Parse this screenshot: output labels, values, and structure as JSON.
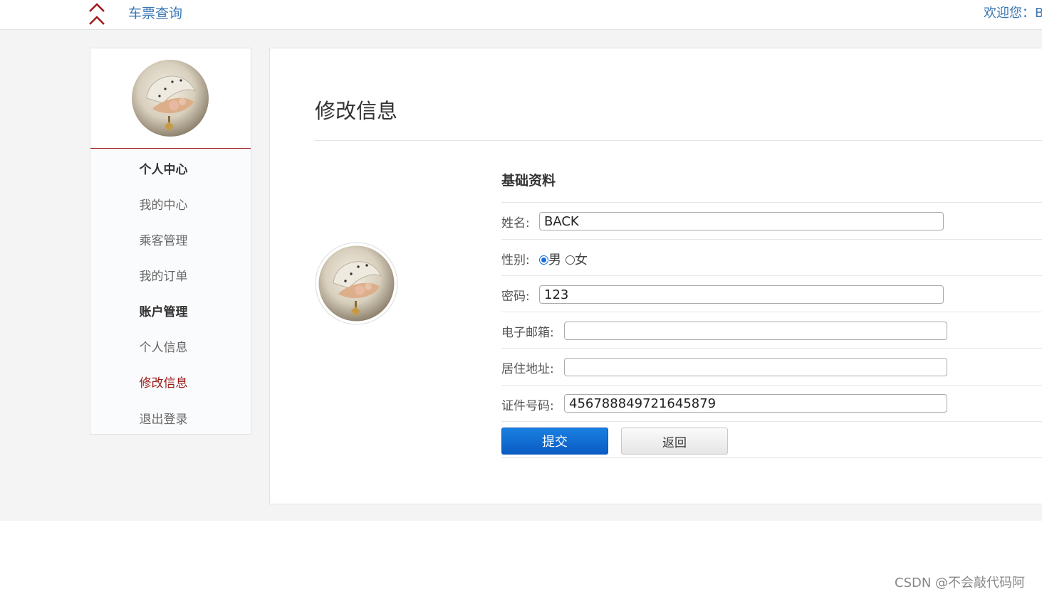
{
  "header": {
    "nav_link": "车票查询",
    "welcome": "欢迎您：B"
  },
  "sidebar": {
    "items": [
      {
        "label": "个人中心",
        "kind": "heading"
      },
      {
        "label": "我的中心",
        "kind": "link"
      },
      {
        "label": "乘客管理",
        "kind": "link"
      },
      {
        "label": "我的订单",
        "kind": "link"
      },
      {
        "label": "账户管理",
        "kind": "heading"
      },
      {
        "label": "个人信息",
        "kind": "link"
      },
      {
        "label": "修改信息",
        "kind": "link-active"
      },
      {
        "label": "退出登录",
        "kind": "link"
      }
    ]
  },
  "main": {
    "title": "修改信息",
    "section_title": "基础资料",
    "form": {
      "name_label": "姓名:",
      "name_value": "BACK",
      "gender_label": "性别:",
      "gender_options": [
        "男",
        "女"
      ],
      "gender_selected": "男",
      "password_label": "密码:",
      "password_value": "123",
      "email_label": "电子邮箱:",
      "email_value": "",
      "address_label": "居住地址:",
      "address_value": "",
      "id_label": "证件号码:",
      "id_value": "456788849721645879"
    },
    "buttons": {
      "submit": "提交",
      "back": "返回"
    }
  },
  "watermark": "CSDN @不会敲代码阿",
  "colors": {
    "accent_red": "#9c1b1b",
    "link_blue": "#3a76b3",
    "button_blue": "#0a5cc4"
  }
}
